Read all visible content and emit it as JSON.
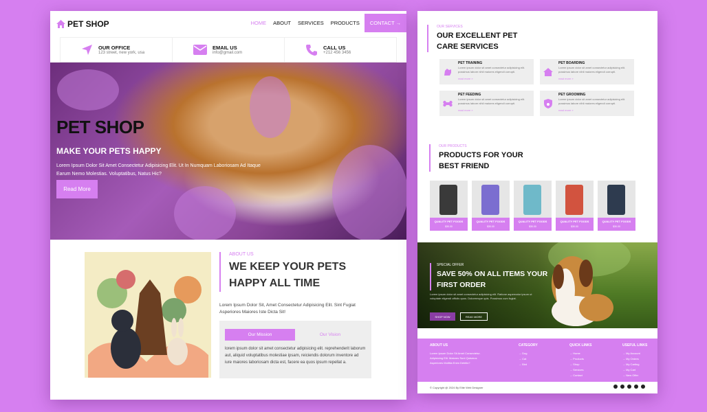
{
  "left": {
    "brand": "PET SHOP",
    "nav": {
      "home": "HOME",
      "about": "ABOUT",
      "services": "SERVICES",
      "products": "PRODUCTS",
      "contact": "CONTACT →"
    },
    "info": [
      {
        "title": "OUR OFFICE",
        "text": "123 street, new york, usa"
      },
      {
        "title": "EMAIL US",
        "text": "info@gmail.com"
      },
      {
        "title": "CALL US",
        "text": "+212 456 3456"
      }
    ],
    "hero": {
      "title": "PET SHOP",
      "subtitle": "MAKE YOUR PETS HAPPY",
      "text": "Lorem Ipsum Dolor Sit Amet Consectetur Adipisicing Elit. Ut In Numquam Laboriosam Ad Itaque Earum Nemo Molestias. Voluptatibus, Natus Hic?",
      "button": "Read More"
    },
    "about": {
      "tagline": "ABOUT US",
      "title_line1": "WE KEEP YOUR PETS",
      "title_line2": "HAPPY ALL TIME",
      "text": "Lorem Ipsum Dolor Sit, Amet Consectetur Adipisicing Elit. Sint Fugiat Asperiores Maiores Iste Dicta Sit!",
      "tab_mission": "Our Mission",
      "tab_vision": "Our Vision",
      "tab_text": "lorem ipsum dolor sit amet consectetur adipisicing elit. reprehenderit laborum aut, aliquid voluptatibus molestiae ipsam, reiciendis dolorum inventore ad iure maiores laboriosam dicta est, facere ea quos ipsum repellat a."
    }
  },
  "right": {
    "services": {
      "tagline": "OUR SERVICES",
      "title_line1": "OUR EXCELLENT PET",
      "title_line2": "CARE SERVICES",
      "items": [
        {
          "title": "PET TRAINING",
          "text": "Lorem ipsum dolor sit amet consectetur adipisicing elit. possimus labore nihil maiores eligendi corrupti.",
          "more": "read more »"
        },
        {
          "title": "PET BOARDING",
          "text": "Lorem ipsum dolor sit amet consectetur adipisicing elit. possimus labore nihil maiores eligendi corrupti.",
          "more": "read more »"
        },
        {
          "title": "PET FEEDING",
          "text": "Lorem ipsum dolor sit amet consectetur adipisicing elit. possimus labore nihil maiores eligendi corrupti.",
          "more": "read more »"
        },
        {
          "title": "PET GROOMING",
          "text": "Lorem ipsum dolor sit amet consectetur adipisicing elit. possimus labore nihil maiores eligendi corrupti.",
          "more": "read more »"
        }
      ]
    },
    "products": {
      "tagline": "OUR PRODUCTS",
      "title_line1": "PRODUCTS FOR YOUR",
      "title_line2": "BEST FRIEND",
      "items": [
        {
          "name": "QUALITY PET FOODS",
          "price": "$30.00",
          "color": "#3a3a3a"
        },
        {
          "name": "QUALITY PET FOODS",
          "price": "$30.00",
          "color": "#7b6ed0"
        },
        {
          "name": "QUALITY PET FOODS",
          "price": "$30.00",
          "color": "#6fb9c9"
        },
        {
          "name": "QUALITY PET FOODS",
          "price": "$30.00",
          "color": "#d2533f"
        },
        {
          "name": "QUALITY PET FOODS",
          "price": "$30.00",
          "color": "#2e3b4f"
        }
      ]
    },
    "offer": {
      "tagline": "SPECIAL OFFER",
      "title_line1": "SAVE 50% ON ALL ITEMS YOUR",
      "title_line2": "FIRST ORDER",
      "text": "Lorem ipsum dolor sit amet consectetur adipisicing elit. Ratione aspernatur ipsum ut voluptate eligendi officiis quos. Doloremque quis. Possimus cum fugiat.",
      "shop_button": "SHOP NOW",
      "read_button": "READ MORE"
    },
    "footer": {
      "about_title": "ABOUT US",
      "about_text": "Lorem Ipsum Dolor Sit Amet Consectetur. Adipisicing Elit. Maiores Sunt Quismus Asperiores Mollitia Enim Debitis?",
      "category_title": "CATEGORY",
      "categories": [
        "→ Dog",
        "→ Cat",
        "→ Bird"
      ],
      "quick_title": "QUICK LINKS",
      "quick_links": [
        "→ Home",
        "→ Products",
        "→ Shop",
        "→ Services",
        "→ Contact"
      ],
      "useful_title": "USEFUL LINKS",
      "useful_links": [
        "→ My Account",
        "→ My Orders",
        "→ My Carting",
        "→ My Cart",
        "→ New Offer"
      ],
      "copyright": "© Copyright @ 2024 By Elite Web Designer"
    }
  }
}
